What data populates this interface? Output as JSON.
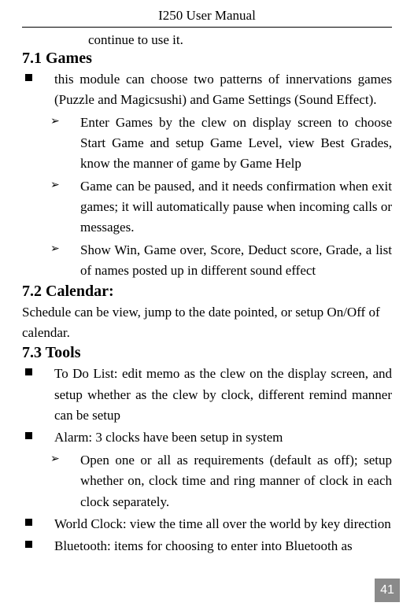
{
  "header": {
    "title": "I250 User Manual"
  },
  "continue_text": "continue to use it.",
  "sections": {
    "games": {
      "heading": "7.1 Games",
      "bullet1": "this module can choose two patterns of innervations games (Puzzle and Magicsushi) and Game Settings (Sound Effect).",
      "sub1": "Enter Games by the clew on display screen to choose Start Game and setup Game Level, view Best Grades, know the manner of game by Game Help",
      "sub2": "Game can be paused, and it needs confirmation when exit games; it will automatically pause when incoming calls or messages.",
      "sub3": "Show Win, Game over, Score, Deduct score, Grade, a list of names posted up in different sound effect"
    },
    "calendar": {
      "heading": "7.2 Calendar:",
      "body": "Schedule can be view, jump to the date pointed, or setup On/Off of calendar."
    },
    "tools": {
      "heading": "7.3 Tools",
      "bullet1": "To Do List: edit memo as the clew on the display screen, and setup whether as the clew by clock, different remind manner can be setup",
      "bullet2": "Alarm: 3 clocks have been setup in system",
      "sub1": "Open one or all as requirements (default as off); setup whether on, clock time and ring manner of clock in each clock separately.",
      "bullet3": "World Clock: view the time all over the world by key direction",
      "bullet4": "Bluetooth: items for choosing to enter into Bluetooth as"
    }
  },
  "arrow_glyph": "➢",
  "page_number": "41"
}
